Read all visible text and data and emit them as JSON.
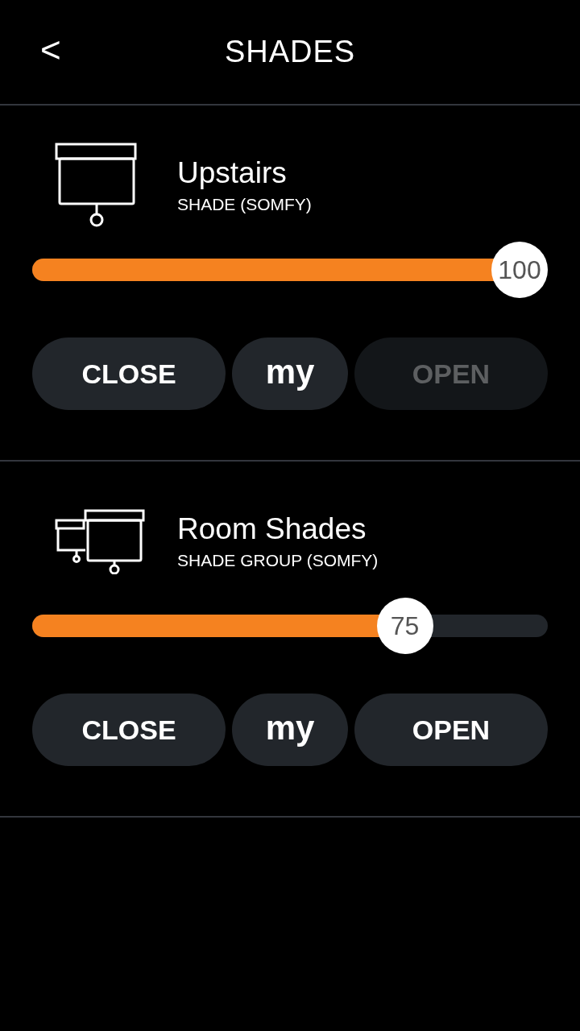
{
  "header": {
    "back": "<",
    "title": "SHADES"
  },
  "devices": [
    {
      "kind": "single",
      "name": "Upstairs",
      "type": "SHADE (SOMFY)",
      "level": 1,
      "reading": "100",
      "buttons": [
        {
          "label": "CLOSE",
          "kind": "wide",
          "disabled": false
        },
        {
          "label": "my",
          "kind": "narrow",
          "disabled": false
        },
        {
          "label": "OPEN",
          "kind": "wide",
          "disabled": true
        }
      ]
    },
    {
      "kind": "group",
      "name": "Room Shades",
      "type": "SHADE GROUP (SOMFY)",
      "level": 0.75,
      "reading": "75",
      "buttons": [
        {
          "label": "CLOSE",
          "kind": "wide",
          "disabled": false
        },
        {
          "label": "my",
          "kind": "narrow",
          "disabled": false
        },
        {
          "label": "OPEN",
          "kind": "wide",
          "disabled": false
        }
      ]
    }
  ]
}
